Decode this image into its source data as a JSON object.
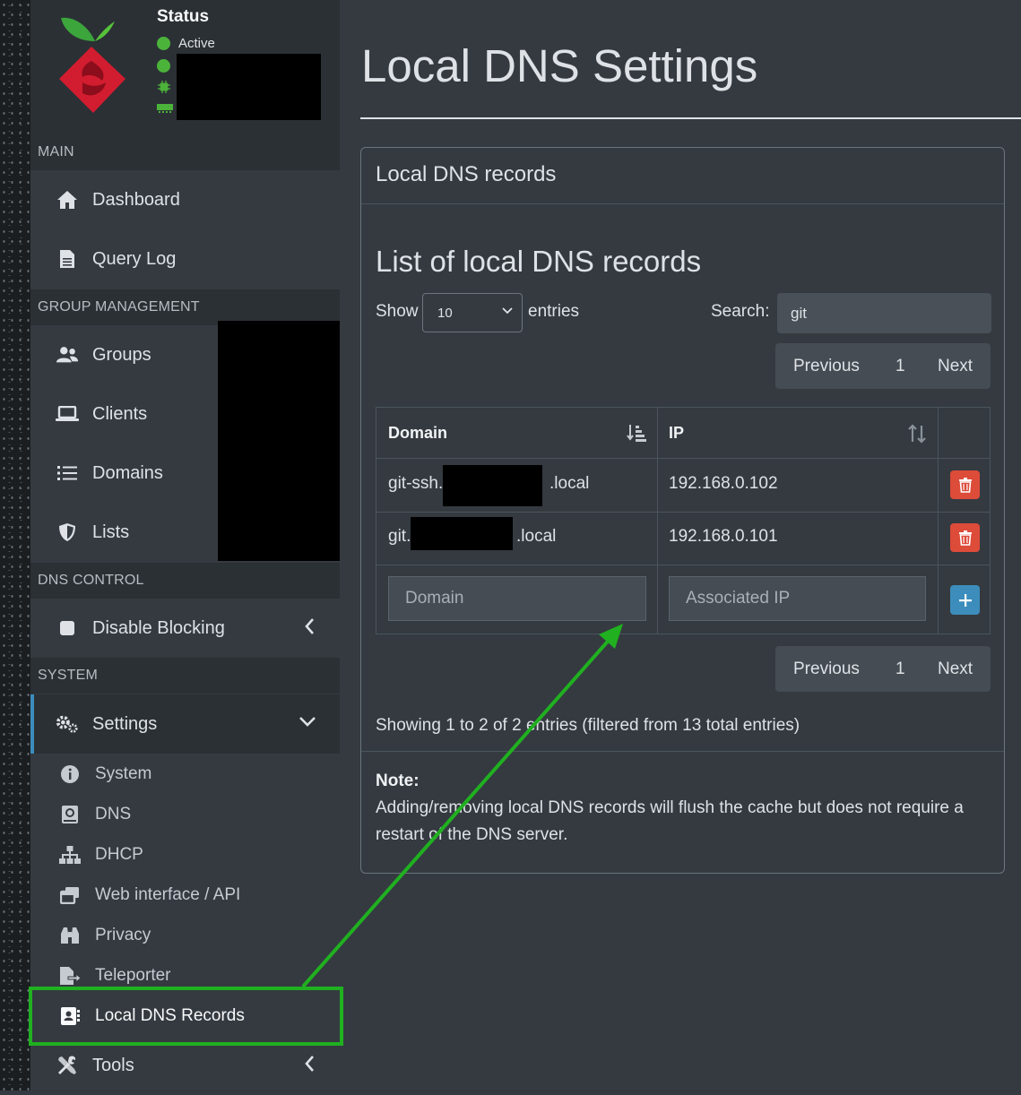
{
  "sidebar": {
    "status": {
      "title": "Status",
      "active": "Active"
    },
    "sections": {
      "main": "MAIN",
      "group_management": "GROUP MANAGEMENT",
      "dns_control": "DNS CONTROL",
      "system": "SYSTEM"
    },
    "items": {
      "dashboard": "Dashboard",
      "query_log": "Query Log",
      "groups": "Groups",
      "clients": "Clients",
      "domains": "Domains",
      "lists": "Lists",
      "disable_blocking": "Disable Blocking",
      "settings": "Settings",
      "tools": "Tools"
    },
    "settings_sub": {
      "system": "System",
      "dns": "DNS",
      "dhcp": "DHCP",
      "web_interface": "Web interface / API",
      "privacy": "Privacy",
      "teleporter": "Teleporter",
      "local_dns_records": "Local DNS Records"
    }
  },
  "main": {
    "page_title": "Local DNS Settings",
    "card_title": "Local DNS records",
    "list_title": "List of local DNS records",
    "show_label": "Show",
    "entries_label": "entries",
    "page_length": "10",
    "search_label": "Search:",
    "search_value": "git",
    "pager": {
      "previous": "Previous",
      "page": "1",
      "next": "Next"
    },
    "table": {
      "headers": {
        "domain": "Domain",
        "ip": "IP"
      },
      "rows": [
        {
          "domain_prefix": "git-ssh.",
          "domain_suffix": ".local",
          "ip": "192.168.0.102"
        },
        {
          "domain_prefix": "git.",
          "domain_suffix": ".local",
          "ip": "192.168.0.101"
        }
      ],
      "domain_placeholder": "Domain",
      "ip_placeholder": "Associated IP"
    },
    "showing_text": "Showing 1 to 2 of 2 entries (filtered from 13 total entries)",
    "note_title": "Note:",
    "note_text": "Adding/removing local DNS records will flush the cache but does not require a restart of the DNS server."
  },
  "colors": {
    "accent": "#3c8dbc",
    "danger": "#dd4b39",
    "status_active": "#4cb33a",
    "annotation": "#20b020"
  }
}
